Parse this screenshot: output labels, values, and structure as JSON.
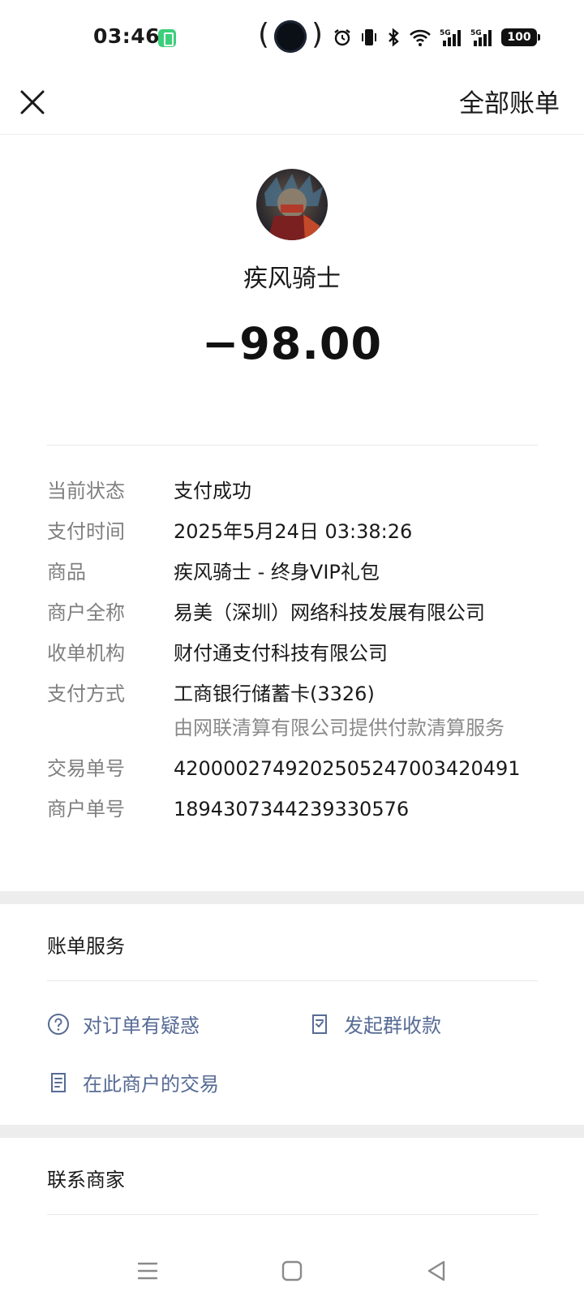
{
  "status_bar": {
    "time": "03:46",
    "battery": "100"
  },
  "header": {
    "all_bills": "全部账单"
  },
  "summary": {
    "merchant_name": "疾风骑士",
    "amount": "−98.00"
  },
  "details": [
    {
      "label": "当前状态",
      "value": "支付成功"
    },
    {
      "label": "支付时间",
      "value": "2025年5月24日 03:38:26"
    },
    {
      "label": "商品",
      "value": "疾风骑士 - 终身VIP礼包"
    },
    {
      "label": "商户全称",
      "value": "易美（深圳）网络科技发展有限公司"
    },
    {
      "label": "收单机构",
      "value": "财付通支付科技有限公司"
    },
    {
      "label": "支付方式",
      "value": "工商银行储蓄卡(3326)",
      "sub": "由网联清算有限公司提供付款清算服务"
    },
    {
      "label": "交易单号",
      "value": "4200002749202505247003420491"
    },
    {
      "label": "商户单号",
      "value": "1894307344239330576"
    }
  ],
  "bill_services": {
    "title": "账单服务",
    "items": [
      "对订单有疑惑",
      "发起群收款",
      "在此商户的交易"
    ]
  },
  "contact": {
    "title": "联系商家"
  },
  "colors": {
    "link": "#576b95",
    "label": "#7f7f7f",
    "section_bg": "#ededed"
  }
}
